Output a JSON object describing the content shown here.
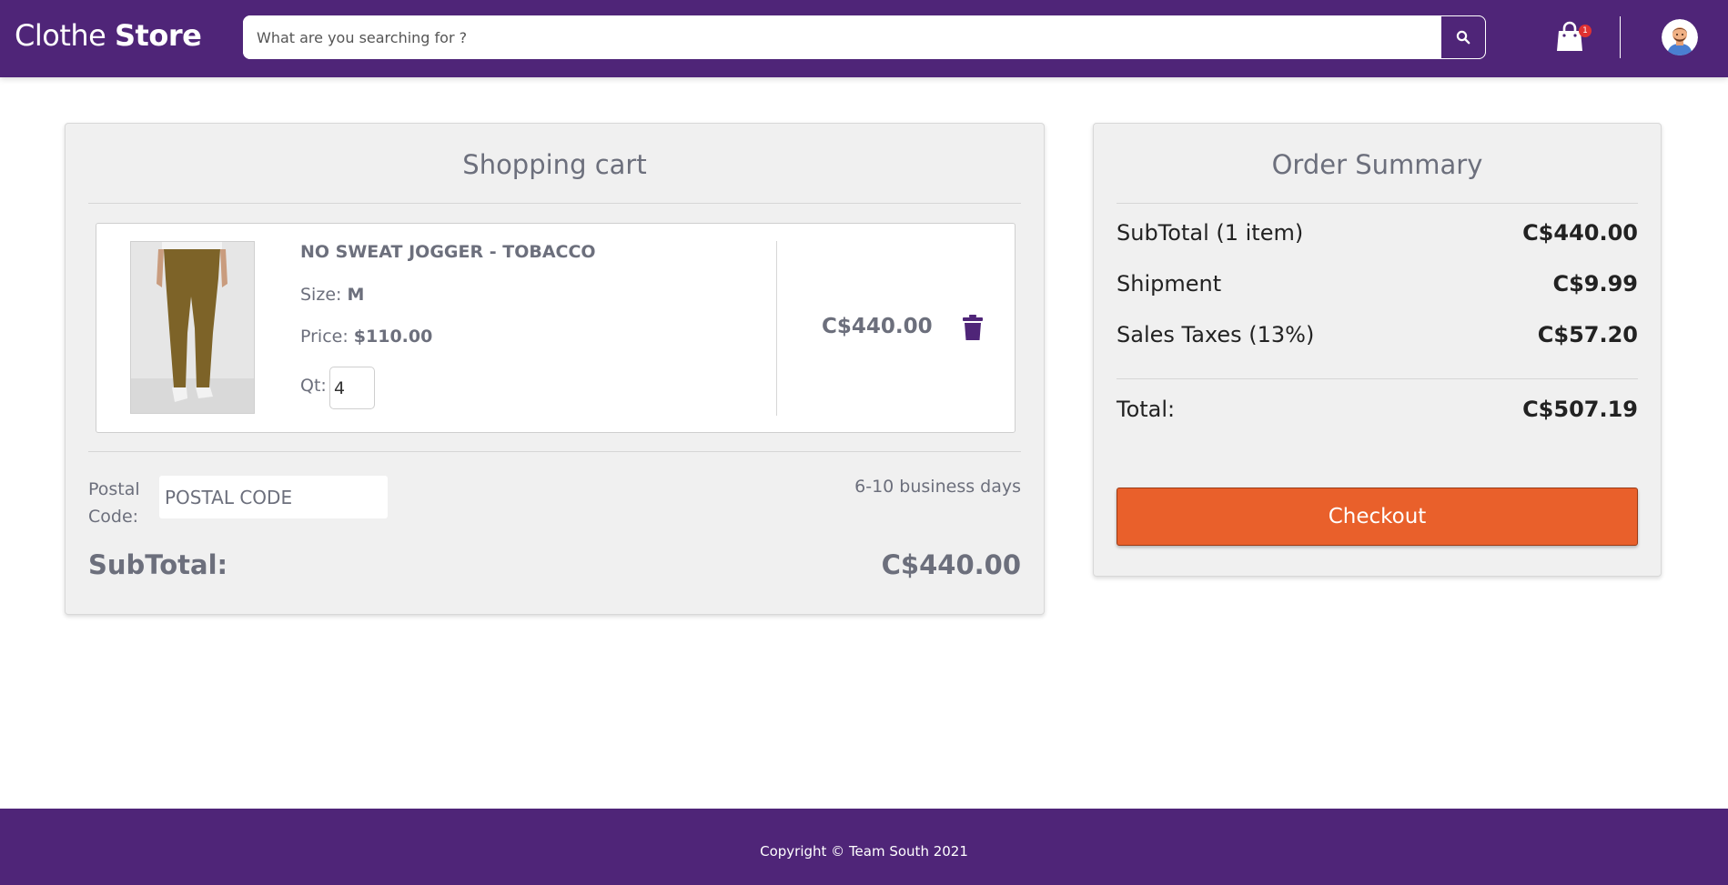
{
  "header": {
    "brand_light": "Clothe ",
    "brand_bold": "Store",
    "search_placeholder": "What are you searching for ?",
    "cart_count": "1"
  },
  "cart": {
    "title": "Shopping cart",
    "item": {
      "name": "NO SWEAT JOGGER - TOBACCO",
      "size_label": "Size: ",
      "size_value": "M",
      "price_label": "Price: ",
      "price_value": "$110.00",
      "qty_label": "Qt:",
      "qty_value": "4",
      "line_total": "C$440.00"
    },
    "postal_label": "Postal Code:",
    "postal_placeholder": "POSTAL CODE",
    "delivery_estimate": "6-10 business days",
    "subtotal_label": "SubTotal:",
    "subtotal_value": "C$440.00"
  },
  "summary": {
    "title": "Order Summary",
    "rows": [
      {
        "label": "SubTotal (1 item)",
        "value": "C$440.00"
      },
      {
        "label": "Shipment",
        "value": "C$9.99"
      },
      {
        "label": "Sales Taxes (13%)",
        "value": "C$57.20"
      }
    ],
    "total_label": "Total:",
    "total_value": "C$507.19",
    "checkout_label": "Checkout"
  },
  "footer": {
    "copyright": "Copyright © Team South 2021"
  },
  "colors": {
    "brand_purple": "#4f2578",
    "checkout_orange": "#e9602b",
    "panel_bg": "#f0f0f0",
    "text_gray": "#6c6f7c"
  },
  "icons": {
    "search": "search-icon",
    "cart": "shopping-bag-icon",
    "avatar": "user-avatar",
    "delete": "trash-icon"
  }
}
